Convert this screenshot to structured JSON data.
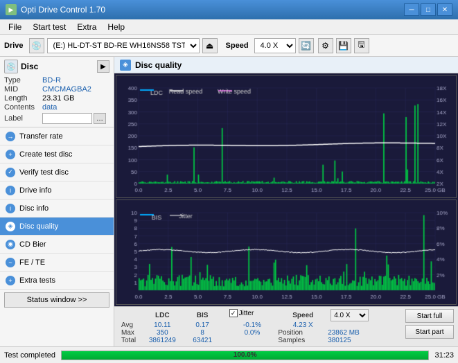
{
  "titleBar": {
    "title": "Opti Drive Control 1.70",
    "minimize": "─",
    "maximize": "□",
    "close": "✕"
  },
  "menuBar": {
    "items": [
      "File",
      "Start test",
      "Extra",
      "Help"
    ]
  },
  "driveToolbar": {
    "driveLabel": "Drive",
    "driveValue": "(E:)  HL-DT-ST BD-RE  WH16NS58 TST4",
    "speedLabel": "Speed",
    "speedValue": "4.0 X"
  },
  "sidebar": {
    "discSection": {
      "title": "Disc",
      "fields": [
        {
          "label": "Type",
          "value": "BD-R"
        },
        {
          "label": "MID",
          "value": "CMCMAGBA2"
        },
        {
          "label": "Length",
          "value": "23.31 GB"
        },
        {
          "label": "Contents",
          "value": "data"
        }
      ],
      "labelField": {
        "label": "Label",
        "placeholder": ""
      }
    },
    "navItems": [
      {
        "id": "transfer-rate",
        "label": "Transfer rate",
        "active": false
      },
      {
        "id": "create-test-disc",
        "label": "Create test disc",
        "active": false
      },
      {
        "id": "verify-test-disc",
        "label": "Verify test disc",
        "active": false
      },
      {
        "id": "drive-info",
        "label": "Drive info",
        "active": false
      },
      {
        "id": "disc-info",
        "label": "Disc info",
        "active": false
      },
      {
        "id": "disc-quality",
        "label": "Disc quality",
        "active": true
      },
      {
        "id": "cd-bier",
        "label": "CD Bier",
        "active": false
      },
      {
        "id": "fe-te",
        "label": "FE / TE",
        "active": false
      },
      {
        "id": "extra-tests",
        "label": "Extra tests",
        "active": false
      }
    ],
    "statusWindowBtn": "Status window >>"
  },
  "contentArea": {
    "title": "Disc quality",
    "chart1": {
      "legend": [
        {
          "label": "LDC",
          "color": "#00aaff"
        },
        {
          "label": "Read speed",
          "color": "#ffffff"
        },
        {
          "label": "Write speed",
          "color": "#ff00ff"
        }
      ],
      "yAxisMax": 400,
      "yAxisRight": [
        "18X",
        "16X",
        "14X",
        "12X",
        "10X",
        "8X",
        "6X",
        "4X",
        "2X"
      ],
      "xAxisLabels": [
        "0.0",
        "2.5",
        "5.0",
        "7.5",
        "10.0",
        "12.5",
        "15.0",
        "17.5",
        "20.0",
        "22.5",
        "25.0 GB"
      ]
    },
    "chart2": {
      "legend": [
        {
          "label": "BIS",
          "color": "#00aaff"
        },
        {
          "label": "Jitter",
          "color": "#ffffff"
        }
      ],
      "yAxisMax": 10,
      "yAxisRight": [
        "10%",
        "8%",
        "6%",
        "4%",
        "2%"
      ],
      "xAxisLabels": [
        "0.0",
        "2.5",
        "5.0",
        "7.5",
        "10.0",
        "12.5",
        "15.0",
        "17.5",
        "20.0",
        "22.5",
        "25.0 GB"
      ]
    }
  },
  "statsBar": {
    "columns": [
      "LDC",
      "BIS",
      "",
      "Jitter",
      "Speed",
      ""
    ],
    "rows": [
      {
        "label": "Avg",
        "ldc": "10.11",
        "bis": "0.17",
        "jitter": "-0.1%",
        "speed": "4.23 X",
        "speedDropdown": "4.0 X"
      },
      {
        "label": "Max",
        "ldc": "350",
        "bis": "8",
        "jitter": "0.0%",
        "speed_label": "Position",
        "speed_val": "23862 MB"
      },
      {
        "label": "Total",
        "ldc": "3861249",
        "bis": "63421",
        "jitter": "",
        "speed_label": "Samples",
        "speed_val": "380125"
      }
    ],
    "jitterChecked": true,
    "jitterLabel": "Jitter",
    "buttons": [
      "Start full",
      "Start part"
    ]
  },
  "statusBar": {
    "text": "Test completed",
    "progress": 100,
    "progressLabel": "100.0%",
    "time": "31:23"
  },
  "colors": {
    "accent": "#4a90d9",
    "ldcLine": "#00aaff",
    "bisLine": "#00aaff",
    "speedLine": "#ffffff",
    "writeLine": "#ff00ff",
    "gridBg": "#1a1a3a",
    "gridLine": "#2a2a5a",
    "barGreen": "#00dd44"
  }
}
